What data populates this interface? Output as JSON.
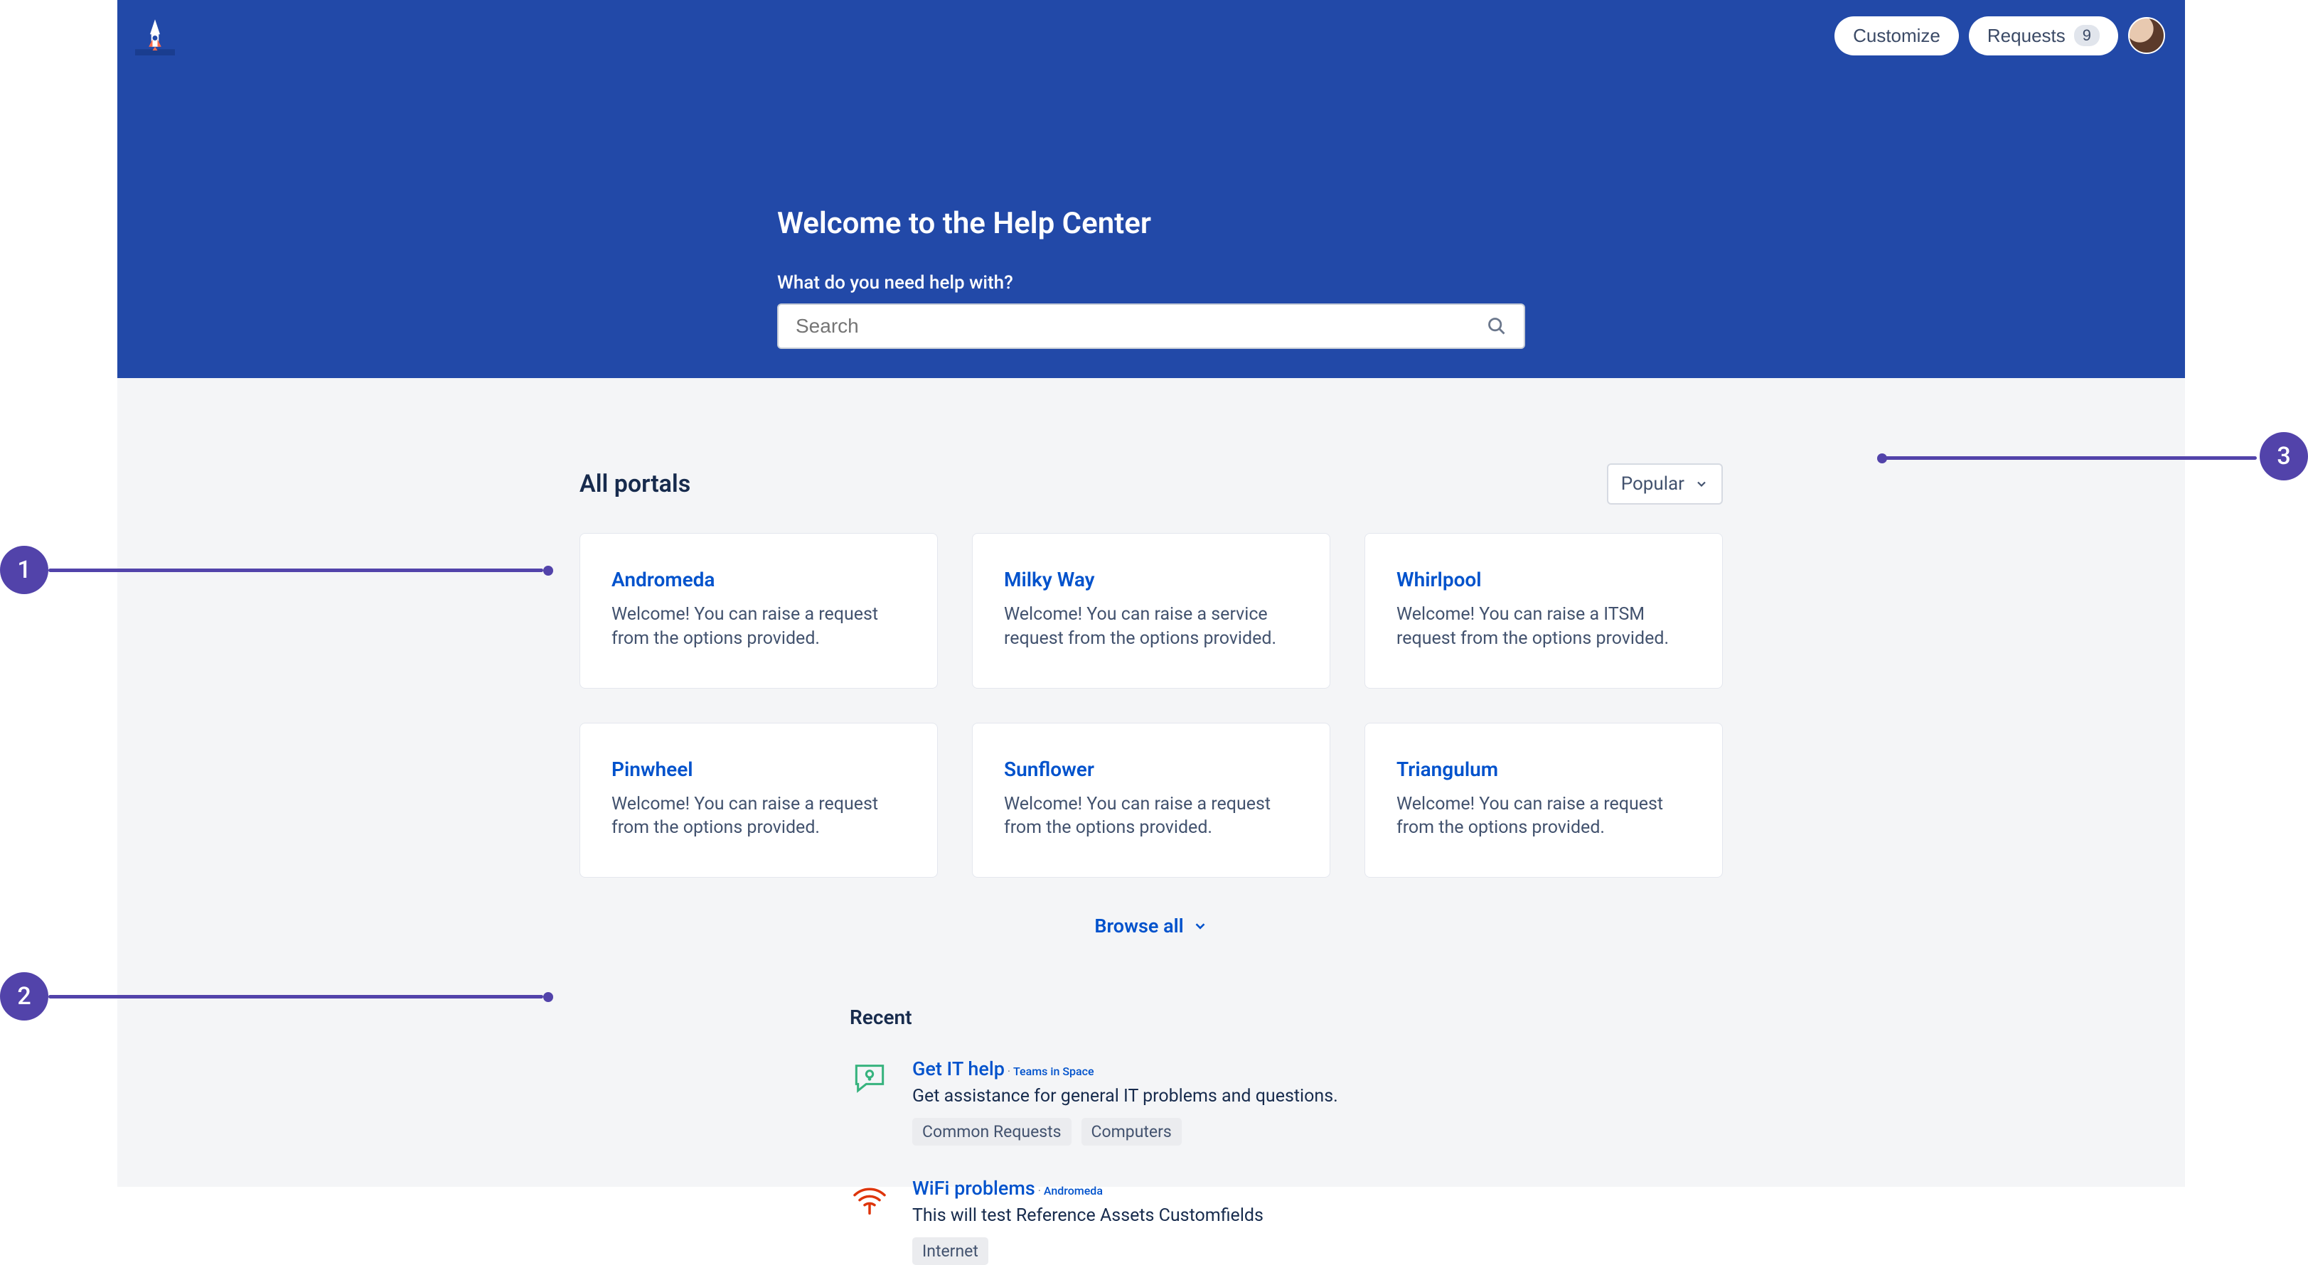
{
  "header": {
    "customize_label": "Customize",
    "requests_label": "Requests",
    "requests_count": "9"
  },
  "hero": {
    "title": "Welcome to the Help Center",
    "search_label": "What do you need help with?",
    "search_placeholder": "Search"
  },
  "portals": {
    "section_title": "All portals",
    "sort_label": "Popular",
    "browse_all_label": "Browse all",
    "items": [
      {
        "title": "Andromeda",
        "desc": "Welcome! You can raise a request from the options provided."
      },
      {
        "title": "Milky Way",
        "desc": "Welcome! You can raise a service request from the options provided."
      },
      {
        "title": "Whirlpool",
        "desc": "Welcome! You can raise a ITSM request from the options provided."
      },
      {
        "title": "Pinwheel",
        "desc": "Welcome! You can raise a request from the options provided."
      },
      {
        "title": "Sunflower",
        "desc": "Welcome! You can raise a request from the options provided."
      },
      {
        "title": "Triangulum",
        "desc": "Welcome! You can raise a request from the options provided."
      }
    ]
  },
  "recent": {
    "section_title": "Recent",
    "items": [
      {
        "title": "Get IT help",
        "separator": " · ",
        "project": "Teams in Space",
        "desc": "Get assistance for general IT problems and questions.",
        "tags": [
          "Common Requests",
          "Computers"
        ],
        "icon": "chat-question"
      },
      {
        "title": "WiFi problems",
        "separator": " · ",
        "project": "Andromeda",
        "desc": "This will test Reference Assets Customfields",
        "tags": [
          "Internet"
        ],
        "icon": "wifi-signal"
      }
    ]
  },
  "annotations": {
    "markers": [
      "1",
      "2",
      "3"
    ]
  }
}
